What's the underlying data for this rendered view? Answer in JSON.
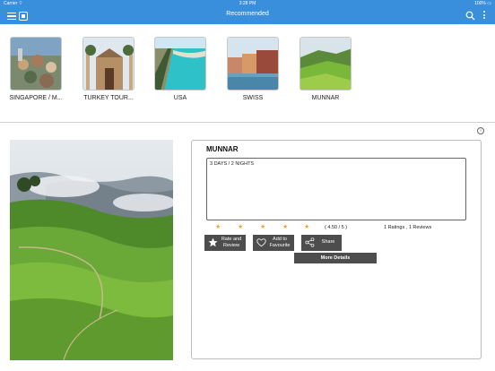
{
  "status_bar": {
    "carrier": "Carrier ⌔",
    "time": "3:28 PM",
    "battery": "100% ▭"
  },
  "header": {
    "title": "Recommended"
  },
  "tours": [
    {
      "name": "SINGAPORE / M..."
    },
    {
      "name": "TURKEY TOUR..."
    },
    {
      "name": "USA"
    },
    {
      "name": "SWISS"
    },
    {
      "name": "MUNNAR"
    }
  ],
  "detail": {
    "title": "MUNNAR",
    "description": "3 DAYS / 2 NIGHTS",
    "rating": "( 4.50 / 5 )",
    "counts": "1 Ratings , 1 Reviews",
    "stars": 5,
    "buttons": {
      "rate_line1": "Rate and",
      "rate_line2": "Review",
      "fav_line1": "Add to",
      "fav_line2": "Favourite",
      "share": "Share",
      "more": "More Details"
    }
  },
  "colors": {
    "accent": "#3a8fdc",
    "button": "#4d4d4d",
    "star": "#e8a93a"
  },
  "icons": [
    "menu-icon",
    "app-logo-icon",
    "search-icon",
    "kebab-icon",
    "info-icon",
    "star-icon",
    "heart-icon",
    "share-icon"
  ]
}
